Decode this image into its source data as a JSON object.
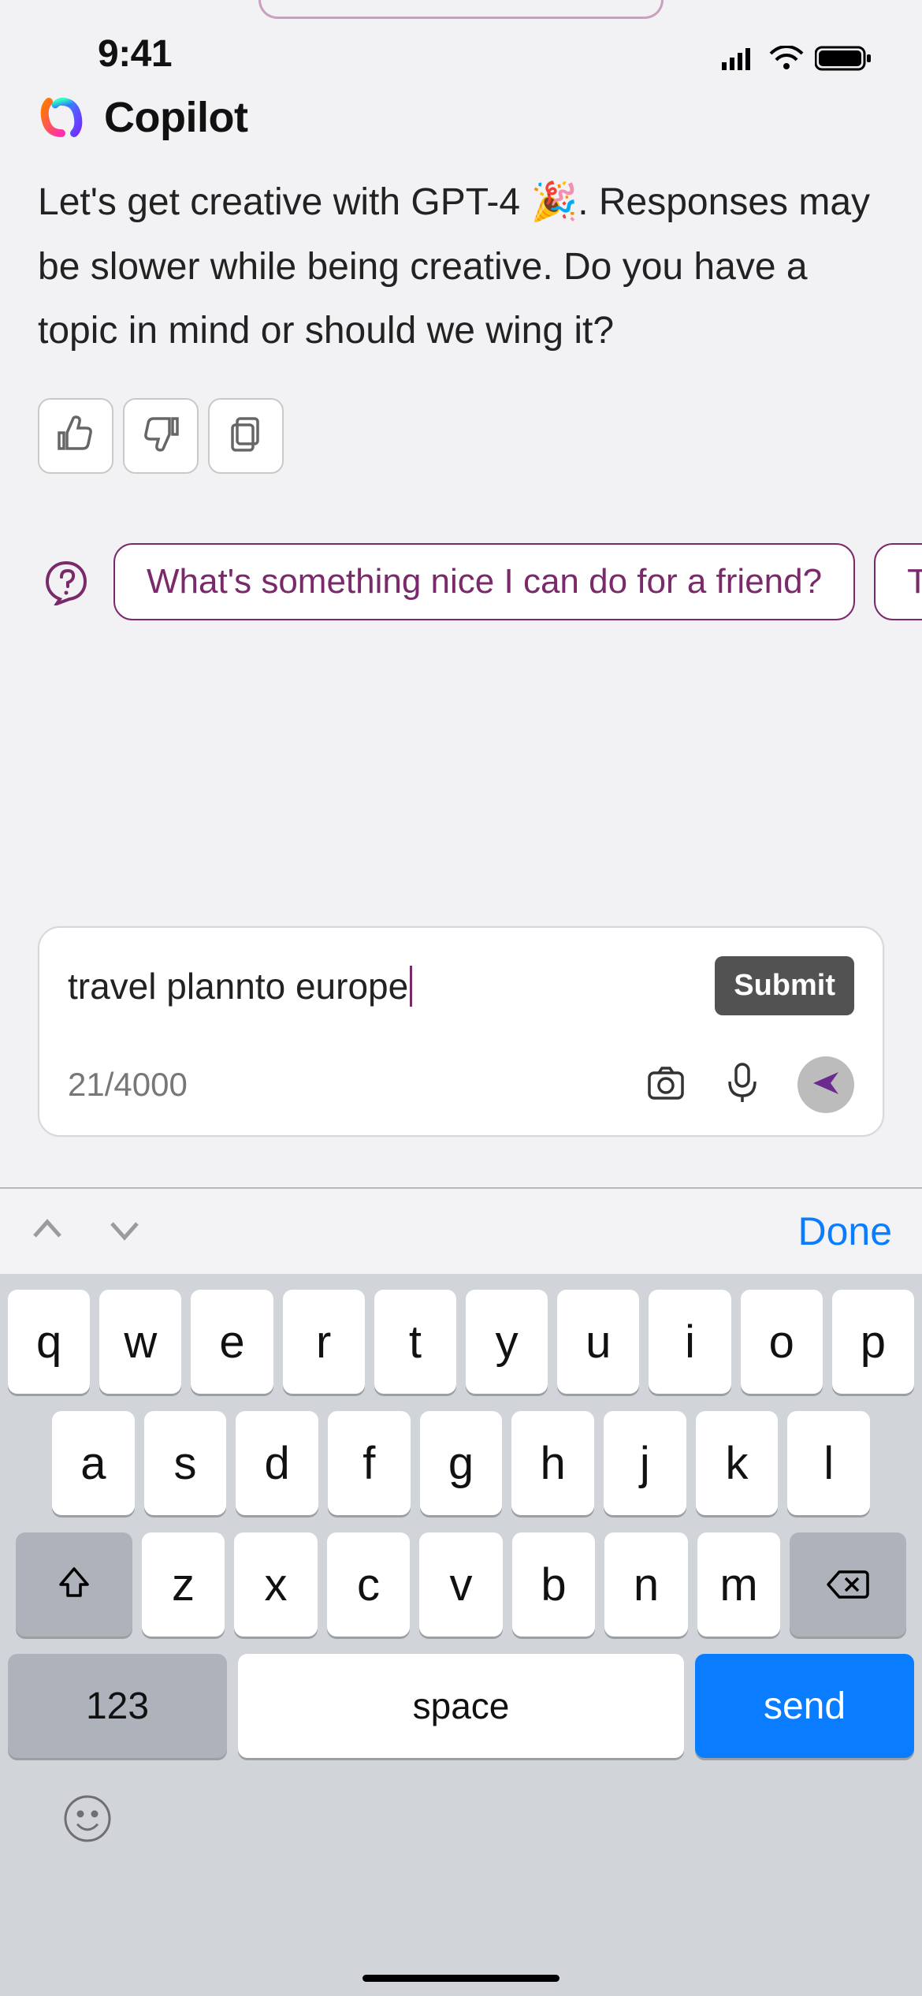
{
  "statusbar": {
    "time": "9:41"
  },
  "header": {
    "title": "Copilot"
  },
  "message": {
    "pre": "Let's get creative with GPT-4 ",
    "emoji": "🎉",
    "post": ". Responses may be slower while being creative. Do you have a topic in mind or should we wing it?"
  },
  "suggestions": {
    "items": [
      "What's something nice I can do for a friend?",
      "Te"
    ]
  },
  "input": {
    "text": "travel plannto europe",
    "counter": "21/4000",
    "submit": "Submit"
  },
  "kbtoolbar": {
    "done": "Done"
  },
  "keyboard": {
    "row1": [
      "q",
      "w",
      "e",
      "r",
      "t",
      "y",
      "u",
      "i",
      "o",
      "p"
    ],
    "row2": [
      "a",
      "s",
      "d",
      "f",
      "g",
      "h",
      "j",
      "k",
      "l"
    ],
    "row3": [
      "z",
      "x",
      "c",
      "v",
      "b",
      "n",
      "m"
    ],
    "numkey": "123",
    "space": "space",
    "send": "send"
  }
}
